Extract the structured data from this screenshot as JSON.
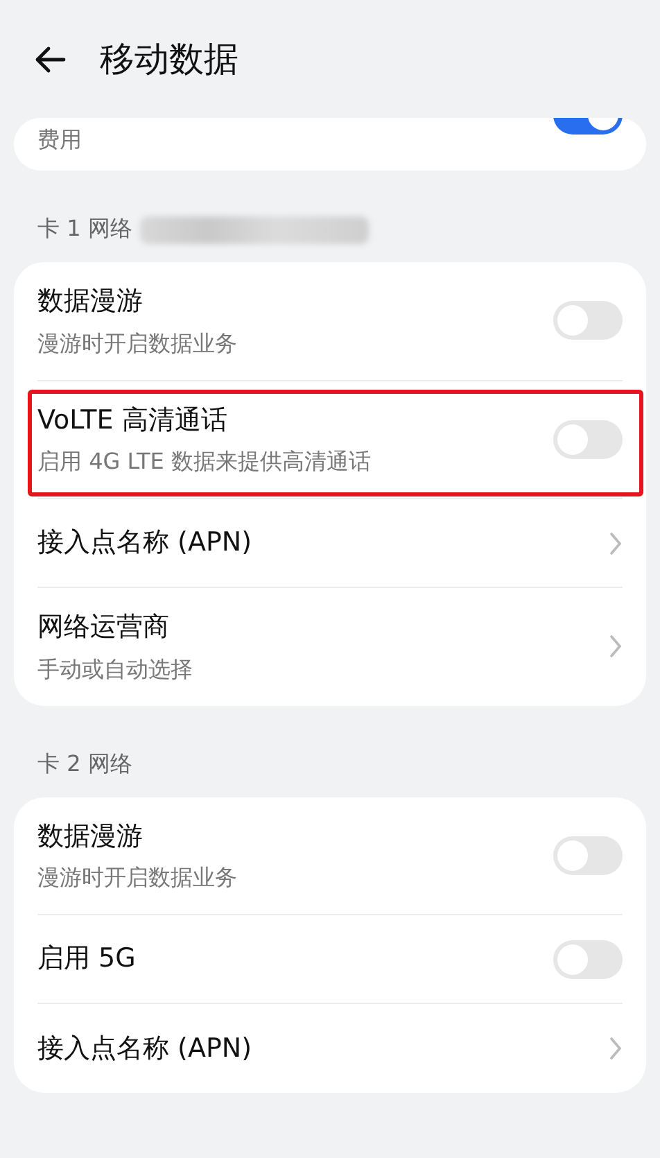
{
  "header": {
    "title": "移动数据"
  },
  "partial_card": {
    "subtitle": "费用",
    "on": true
  },
  "sections": [
    {
      "title": "卡 1 网络",
      "redacted": true,
      "items": [
        {
          "kind": "switch",
          "title": "数据漫游",
          "subtitle": "漫游时开启数据业务",
          "on": false,
          "highlighted": false
        },
        {
          "kind": "switch",
          "title": "VoLTE 高清通话",
          "subtitle": "启用 4G LTE 数据来提供高清通话",
          "on": false,
          "highlighted": true
        },
        {
          "kind": "link",
          "title": "接入点名称 (APN)"
        },
        {
          "kind": "link",
          "title": "网络运营商",
          "subtitle": "手动或自动选择"
        }
      ]
    },
    {
      "title": "卡 2 网络",
      "redacted": false,
      "items": [
        {
          "kind": "switch",
          "title": "数据漫游",
          "subtitle": "漫游时开启数据业务",
          "on": false,
          "highlighted": false
        },
        {
          "kind": "switch",
          "title": "启用 5G",
          "on": false,
          "highlighted": false
        },
        {
          "kind": "link",
          "title": "接入点名称 (APN)"
        }
      ]
    }
  ]
}
